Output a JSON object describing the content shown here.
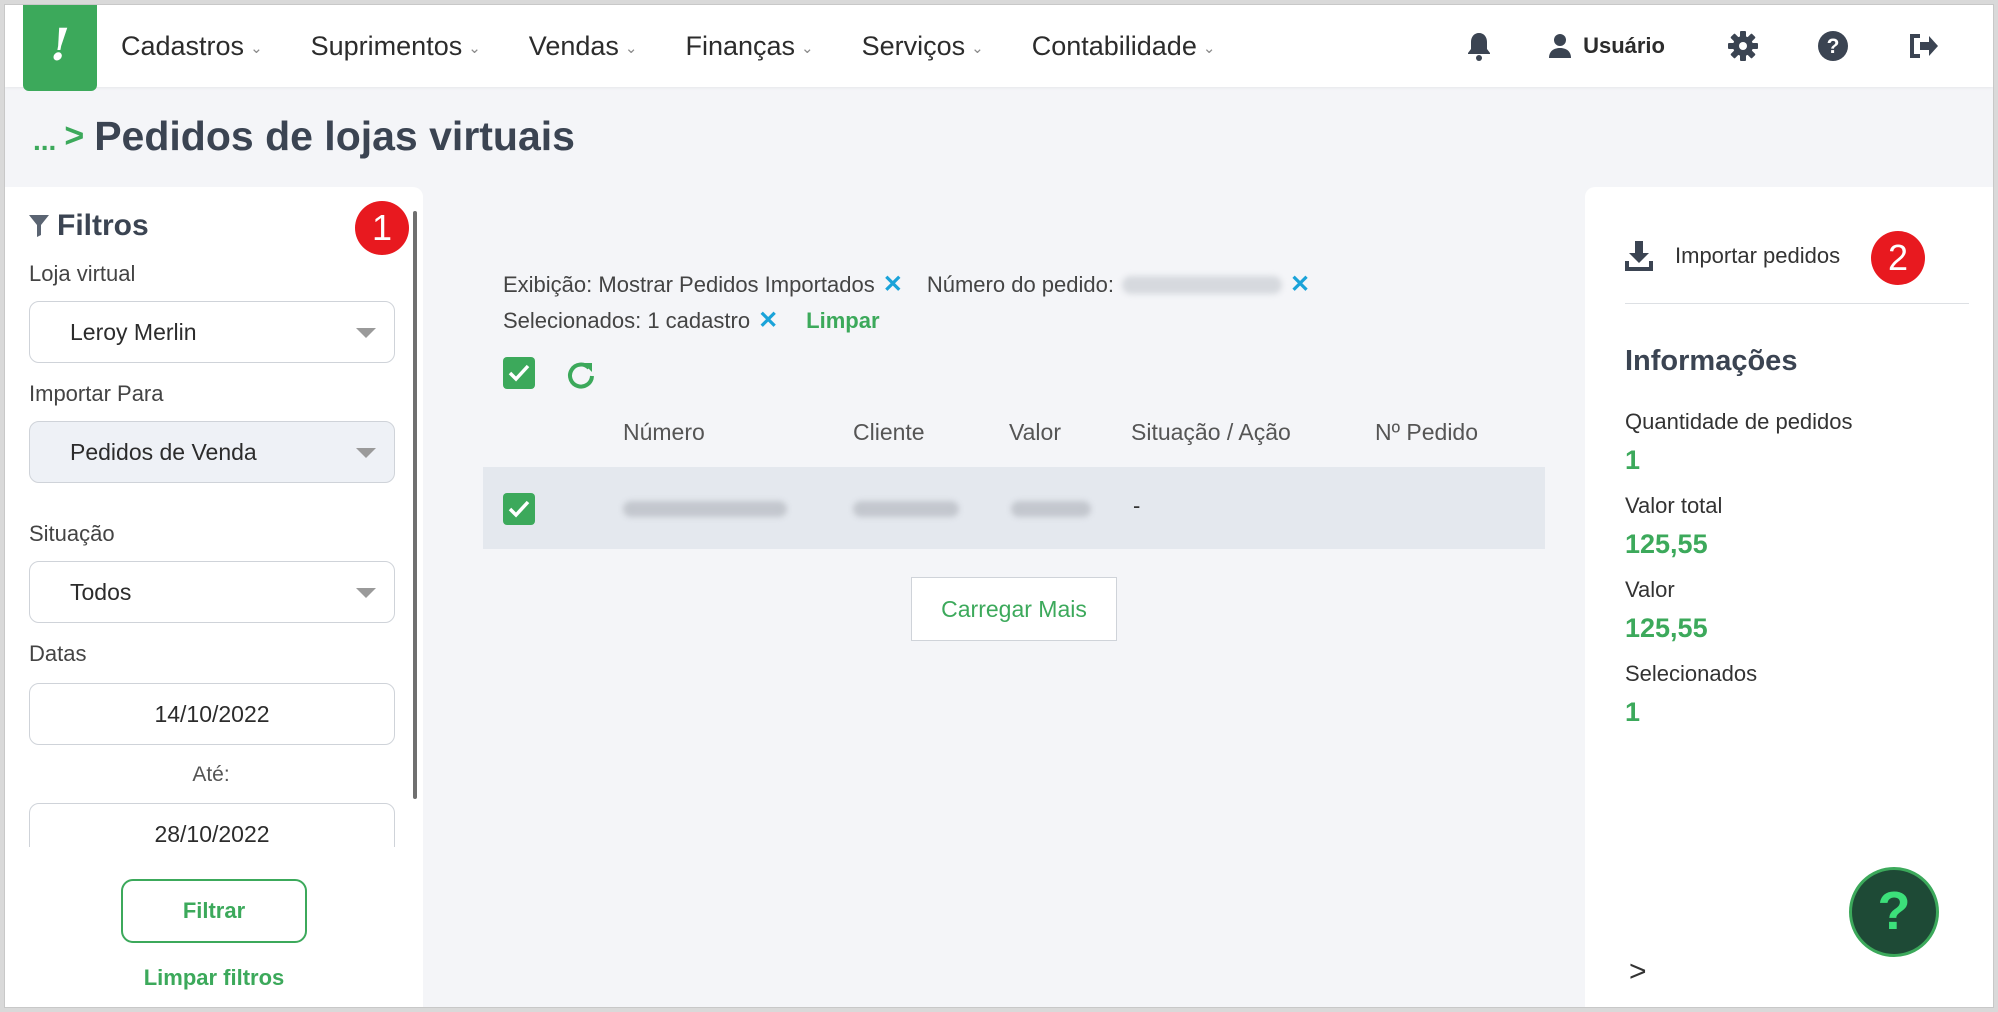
{
  "header": {
    "logo_glyph": "!",
    "nav": [
      {
        "label": "Cadastros"
      },
      {
        "label": "Suprimentos"
      },
      {
        "label": "Vendas"
      },
      {
        "label": "Finanças"
      },
      {
        "label": "Serviços"
      },
      {
        "label": "Contabilidade"
      }
    ],
    "user_label": "Usuário",
    "icons": [
      "bell-icon",
      "user-icon",
      "gear-icon",
      "help-icon",
      "logout-icon"
    ]
  },
  "breadcrumb": {
    "dots": "...",
    "separator": ">",
    "title": "Pedidos de lojas virtuais"
  },
  "filters": {
    "title": "Filtros",
    "badge": "1",
    "loja_label": "Loja virtual",
    "loja_value": "Leroy Merlin",
    "importar_label": "Importar Para",
    "importar_value": "Pedidos de Venda",
    "situacao_label": "Situação",
    "situacao_value": "Todos",
    "datas_label": "Datas",
    "date_from": "14/10/2022",
    "ate_label": "Até:",
    "date_to": "28/10/2022",
    "filter_button": "Filtrar",
    "clear_filters": "Limpar filtros"
  },
  "chips": {
    "exibicao": "Exibição: Mostrar Pedidos Importados",
    "numero": "Número do pedido:",
    "selecionados": "Selecionados: 1 cadastro",
    "limpar": "Limpar",
    "remove_glyph": "✕"
  },
  "table": {
    "columns": [
      "Número",
      "Cliente",
      "Valor",
      "Situação / Ação",
      "Nº Pedido"
    ],
    "rows": [
      {
        "situacao": "-"
      }
    ],
    "load_more": "Carregar Mais"
  },
  "right_panel": {
    "import_label": "Importar pedidos",
    "badge": "2",
    "info_title": "Informações",
    "items": [
      {
        "label": "Quantidade de pedidos",
        "value": "1"
      },
      {
        "label": "Valor total",
        "value": "125,55"
      },
      {
        "label": "Valor",
        "value": "125,55"
      },
      {
        "label": "Selecionados",
        "value": "1"
      }
    ],
    "help_glyph": "?",
    "expand_glyph": ">"
  },
  "colors": {
    "accent": "#3ca95b",
    "badge": "#e8191f",
    "link_blue": "#1aa3d9"
  }
}
